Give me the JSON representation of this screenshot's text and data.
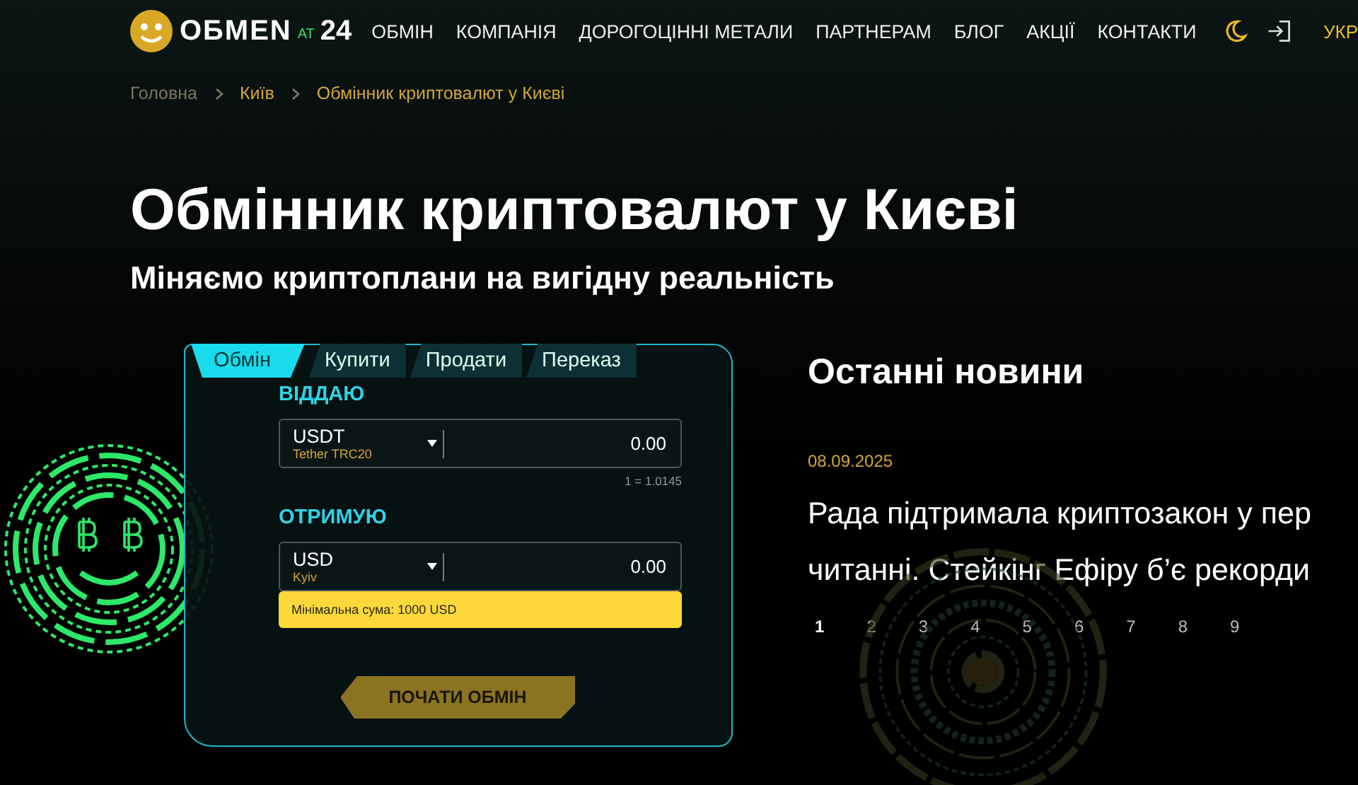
{
  "header": {
    "logo": {
      "name": "OБMEN",
      "mid": "AT",
      "num": "24"
    },
    "nav": [
      {
        "label": "ОБМІН"
      },
      {
        "label": "КОМПАНІЯ"
      },
      {
        "label": "ДОРОГОЦІННІ МЕТАЛИ"
      },
      {
        "label": "ПАРТНЕРАМ"
      },
      {
        "label": "БЛОГ"
      },
      {
        "label": "АКЦІЇ"
      },
      {
        "label": "КОНТАКТИ"
      }
    ],
    "language": {
      "label": "УКР",
      "selected": true
    }
  },
  "breadcrumbs": [
    {
      "label": "Головна"
    },
    {
      "label": "Київ"
    },
    {
      "label": "Обмінник криптовалют у Києві"
    }
  ],
  "title": "Обмінник криптовалют у Києві",
  "subtitle": "Міняємо криптоплани на вигідну реальність",
  "exchange": {
    "tabs": [
      {
        "label": "Обмін",
        "selected": true
      },
      {
        "label": "Купити",
        "selected": false
      },
      {
        "label": "Продати",
        "selected": false
      },
      {
        "label": "Переказ",
        "selected": false
      }
    ],
    "give": {
      "label": "ВІДДАЮ",
      "currency": "USDT",
      "network": "Tether TRC20",
      "amount": "0.00",
      "rate": "1 = 1.0145"
    },
    "receive": {
      "label": "ОТРИМУЮ",
      "currency": "USD",
      "network": "Kyiv",
      "amount": "0.00",
      "hint": "Мінімальна сума: 1000 USD"
    },
    "button": "ПОЧАТИ ОБМІН"
  },
  "news": {
    "heading": "Останні новини",
    "date": "08.09.2025",
    "headline_lines": [
      "Рада підтримала криптозакон у пер",
      "читанні. Стейкінг Ефіру б’є рекорди"
    ],
    "pages": [
      {
        "label": "1",
        "selected": true
      },
      {
        "label": "2",
        "selected": false
      },
      {
        "label": "3",
        "selected": false
      },
      {
        "label": "4",
        "selected": false
      },
      {
        "label": "5",
        "selected": false
      },
      {
        "label": "6",
        "selected": false
      },
      {
        "label": "7",
        "selected": false
      },
      {
        "label": "8",
        "selected": false
      },
      {
        "label": "9",
        "selected": false
      }
    ]
  }
}
